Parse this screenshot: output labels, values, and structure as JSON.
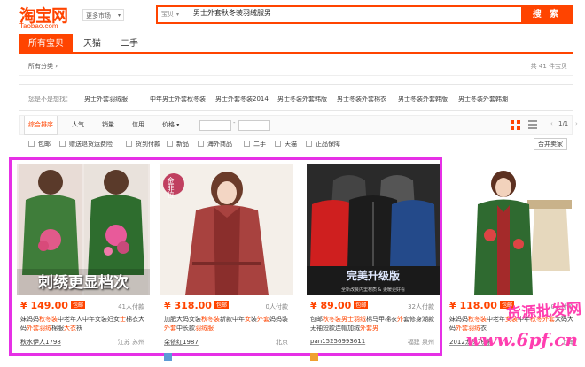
{
  "header": {
    "logo_cn": "淘宝网",
    "logo_en": "Taobao.com",
    "market": "更多市场",
    "search_category": "宝贝",
    "search_value": "男士外套秋冬装羽绒服男",
    "search_button": "搜 索"
  },
  "tabs": [
    {
      "label": "所有宝贝",
      "active": true
    },
    {
      "label": "天猫",
      "active": false
    },
    {
      "label": "二手",
      "active": false
    }
  ],
  "category_row": {
    "all_categories": "所有分类",
    "arrow": "›",
    "total": "共 41 件宝贝"
  },
  "suggestions": {
    "label": "您是不是想找：",
    "items": [
      "男士外套羽绒服",
      "中年男士外套秋冬装",
      "男士外套冬装2014",
      "男士冬装外套韩版",
      "男士冬装外套棉衣",
      "男士冬装外套韩版",
      "男士冬装外套韩潮"
    ]
  },
  "sort": {
    "items": [
      "综合排序",
      "人气",
      "销量",
      "信用",
      "价格"
    ],
    "price_sep": "-",
    "page": "1/1",
    "prev": "‹",
    "next": "›"
  },
  "filters": {
    "items": [
      "包邮",
      "赠送退货运费险",
      "货到付款",
      "新品",
      "海外商品",
      "二手",
      "天猫",
      "正品保障"
    ],
    "merge_button": "合并卖家"
  },
  "products": [
    {
      "price": "¥ 149.00",
      "badge": "包邮",
      "paid": "41人付款",
      "title_parts": [
        [
          "妹妈妈",
          ""
        ],
        [
          "秋冬装",
          "hl"
        ],
        [
          "中老年人中年女装妇女",
          ""
        ],
        [
          "士",
          "hl"
        ],
        [
          "棉衣大码",
          ""
        ],
        [
          "外套羽绒",
          "hl"
        ],
        [
          "棉服",
          ""
        ],
        [
          "大衣",
          "hl"
        ],
        [
          "袄",
          ""
        ]
      ],
      "shop": "秋水伊人1798",
      "location": "江苏 苏州",
      "image_caption": "刺绣更显档次"
    },
    {
      "price": "¥ 318.00",
      "badge": "包邮",
      "paid": "0人付款",
      "title_parts": [
        [
          "加肥大码女装",
          ""
        ],
        [
          "秋冬装",
          "hl"
        ],
        [
          "新款中年",
          ""
        ],
        [
          "女",
          "hl"
        ],
        [
          "装",
          ""
        ],
        [
          "外套",
          "hl"
        ],
        [
          "妈妈装",
          ""
        ],
        [
          "外套",
          "hl"
        ],
        [
          "中长款",
          ""
        ],
        [
          "羽绒服",
          "hl"
        ]
      ],
      "shop": "朵依红1987",
      "location": "北京",
      "image_caption": "金菲拉"
    },
    {
      "price": "¥ 89.00",
      "badge": "包邮",
      "paid": "32人付款",
      "title_parts": [
        [
          "包邮",
          ""
        ],
        [
          "秋冬装男士羽绒",
          "hl"
        ],
        [
          "棉马甲棉衣",
          ""
        ],
        [
          "外",
          "hl"
        ],
        [
          "套",
          ""
        ],
        [
          "修身潮款",
          ""
        ],
        [
          "无袖",
          ""
        ],
        [
          "短款",
          ""
        ],
        [
          "连帽加绒",
          ""
        ],
        [
          "外套",
          "hl"
        ],
        [
          "男",
          "hl"
        ],
        [
          "",
          ""
        ]
      ],
      "shop": "pan15256993611",
      "location": "福建 泉州",
      "image_caption": "完美升级版",
      "image_subcaption": "全新改良内里材质 & 更暖更好看"
    },
    {
      "price": "¥ 118.00",
      "badge": "包邮",
      "paid": "0人付款",
      "title_parts": [
        [
          "妹妈妈",
          ""
        ],
        [
          "秋冬装",
          "hl"
        ],
        [
          "中老年",
          ""
        ],
        [
          "女装",
          "hl"
        ],
        [
          "中年",
          ""
        ],
        [
          "秋冬",
          "hl"
        ],
        [
          "外套",
          "hl"
        ],
        [
          "大码大码",
          ""
        ],
        [
          "外套羽绒",
          "hl"
        ],
        [
          "衣",
          ""
        ]
      ],
      "shop": "2012龙凤飞腾",
      "location": "上海",
      "image_caption": ""
    }
  ],
  "watermark": {
    "line1": "货源批发网",
    "line2": "www.6pf.cn"
  },
  "colors": {
    "accent": "#ff4400",
    "highlight_box": "#e630e6",
    "watermark": "#ff3fb0"
  }
}
